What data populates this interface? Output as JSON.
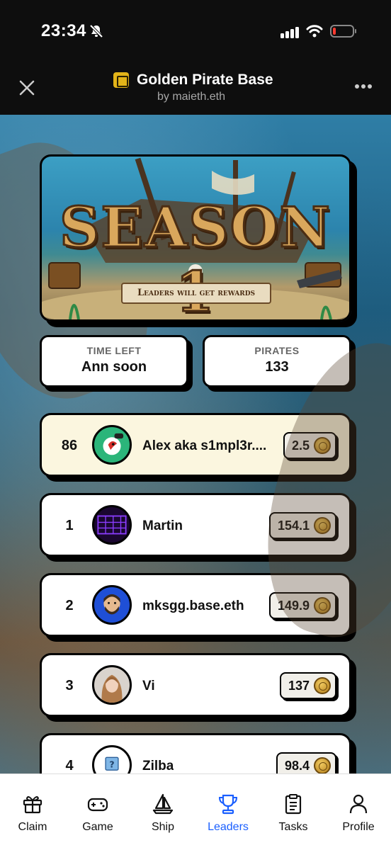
{
  "status_bar": {
    "time": "23:34"
  },
  "header": {
    "title": "Golden Pirate Base",
    "subtitle": "by maieth.eth"
  },
  "banner": {
    "title": "SEASON 1",
    "ribbon": "Leaders will get rewards"
  },
  "stats": {
    "time_left": {
      "label": "TIME LEFT",
      "value": "Ann soon"
    },
    "pirates": {
      "label": "PIRATES",
      "value": "133"
    }
  },
  "leaderboard": [
    {
      "rank": "86",
      "name": "Alex aka s1mpl3r....",
      "score": "2.5",
      "avatar": "parrot-avatar",
      "current_user": true
    },
    {
      "rank": "1",
      "name": "Martin",
      "score": "154.1",
      "avatar": "purple-grid-avatar"
    },
    {
      "rank": "2",
      "name": "mksgg.base.eth",
      "score": "149.9",
      "avatar": "bearded-man-avatar"
    },
    {
      "rank": "3",
      "name": "Vi",
      "score": "137",
      "avatar": "woman-photo-avatar"
    },
    {
      "rank": "4",
      "name": "Zilba",
      "score": "98.4",
      "avatar": "question-mark-avatar"
    }
  ],
  "nav": {
    "items": [
      {
        "label": "Claim",
        "icon": "gift-icon"
      },
      {
        "label": "Game",
        "icon": "gamepad-icon"
      },
      {
        "label": "Ship",
        "icon": "sailboat-icon"
      },
      {
        "label": "Leaders",
        "icon": "trophy-icon",
        "active": true
      },
      {
        "label": "Tasks",
        "icon": "clipboard-icon"
      },
      {
        "label": "Profile",
        "icon": "person-icon"
      }
    ]
  },
  "colors": {
    "accent": "#1a5fff",
    "highlight_row": "#fbf6df",
    "coin": "#d9a23a"
  }
}
